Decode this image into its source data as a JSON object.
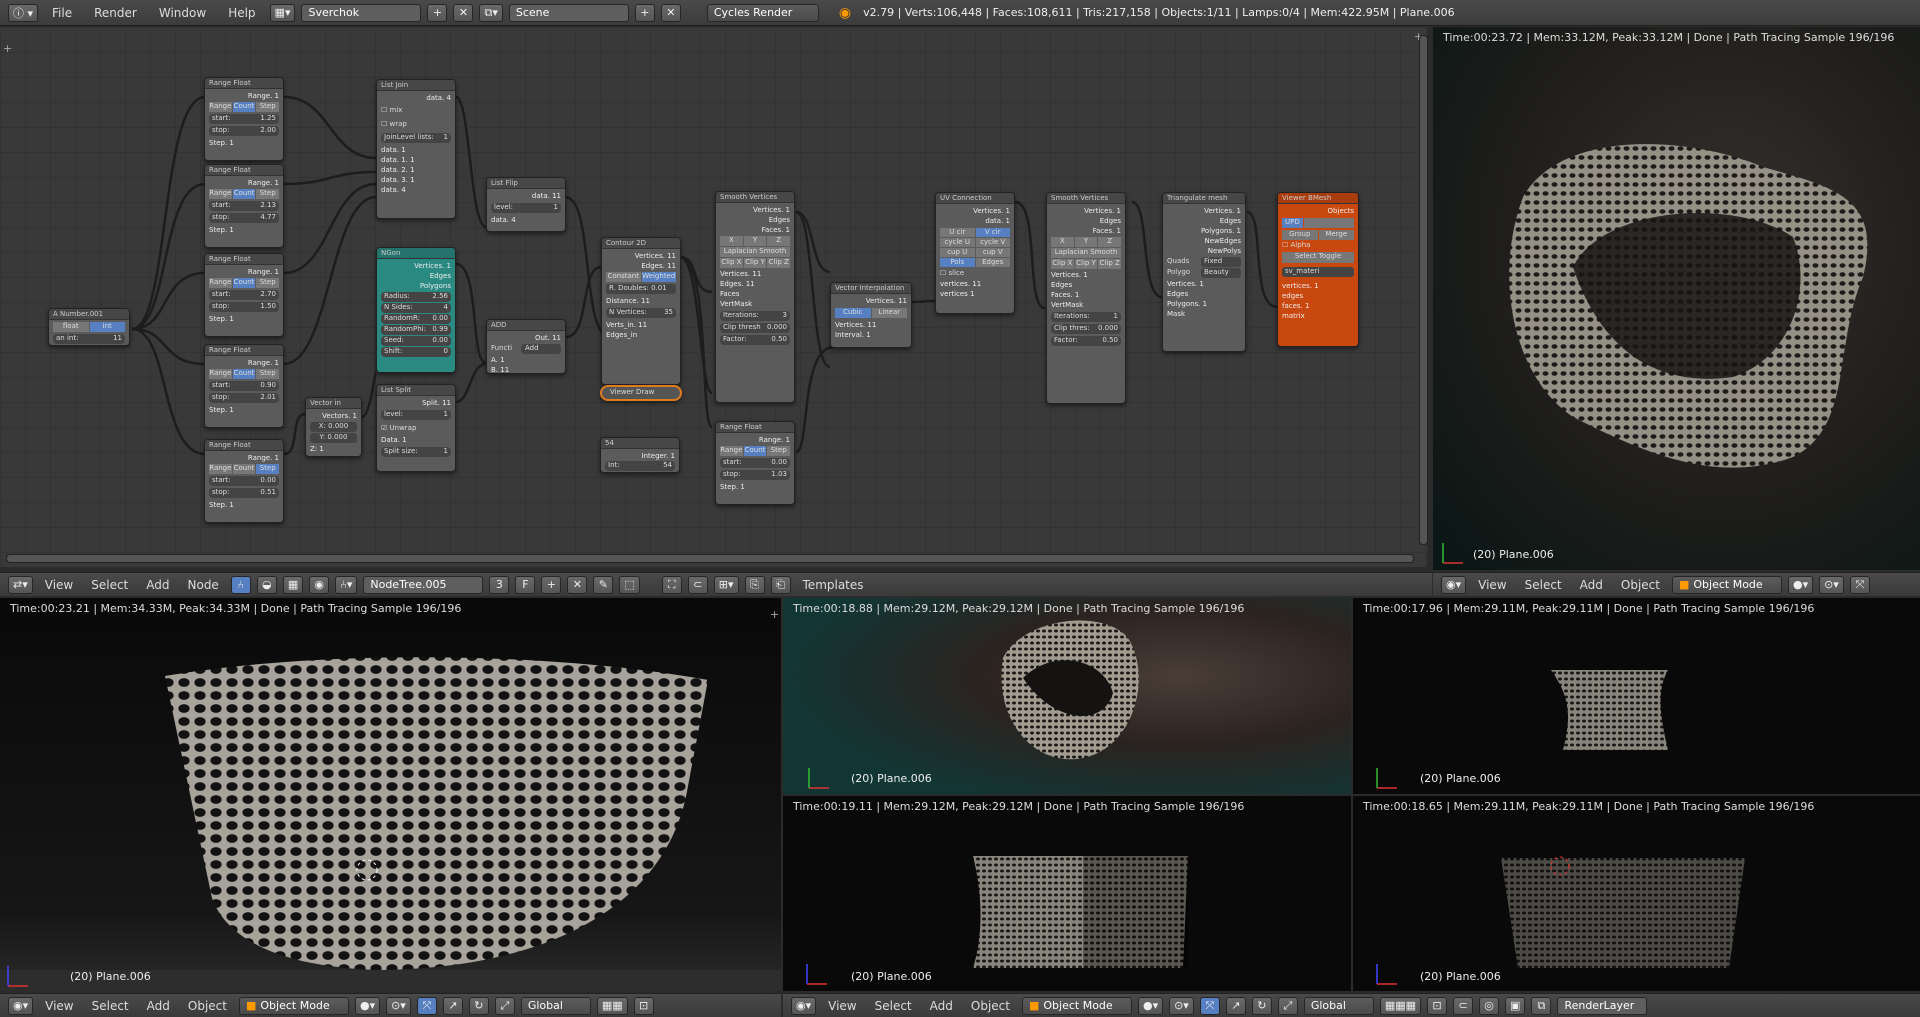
{
  "header": {
    "menus": [
      "File",
      "Render",
      "Window",
      "Help"
    ],
    "screen_name": "Sverchok",
    "scene_name": "Scene",
    "render_engine": "Cycles Render",
    "info": "v2.79 | Verts:106,448 | Faces:108,611 | Tris:217,158 | Objects:1/11 | Lamps:0/4 | Mem:422.95M | Plane.006"
  },
  "node_editor": {
    "toolbar": {
      "menus": [
        "View",
        "Select",
        "Add",
        "Node"
      ],
      "tree_name": "NodeTree.005",
      "users": "3",
      "fake_user": "F",
      "templates": "Templates"
    },
    "nodes": {
      "range1": {
        "title": "Range Float",
        "out": "Range. 1",
        "modes": [
          "Range",
          "Count",
          "Step"
        ],
        "start": "start:",
        "start_v": "1.25",
        "stop": "stop:",
        "stop_v": "2.00",
        "step": "Step. 1"
      },
      "range2": {
        "title": "Range Float",
        "out": "Range. 1",
        "modes": [
          "Range",
          "Count",
          "Step"
        ],
        "start": "start:",
        "start_v": "2.13",
        "stop": "stop:",
        "stop_v": "4.77",
        "step": "Step. 1"
      },
      "range3": {
        "title": "Range Float",
        "out": "Range. 1",
        "modes": [
          "Range",
          "Count",
          "Step"
        ],
        "start": "start:",
        "start_v": "2.70",
        "stop": "stop:",
        "stop_v": "1.50",
        "step": "Step. 1"
      },
      "range4": {
        "title": "Range Float",
        "out": "Range. 1",
        "modes": [
          "Range",
          "Count",
          "Step"
        ],
        "start": "start:",
        "start_v": "0.90",
        "stop": "stop:",
        "stop_v": "2.01",
        "step": "Step. 1"
      },
      "range5": {
        "title": "Range Float",
        "out": "Range. 1",
        "modes": [
          "Range",
          "Count",
          "Step"
        ],
        "start": "start:",
        "start_v": "0.00",
        "stop": "stop:",
        "stop_v": "0.51",
        "step": "Step. 1"
      },
      "anumber": {
        "title": "A Number.001",
        "mode_a": "float",
        "mode_b": "int",
        "val": "an int:",
        "val_v": "11"
      },
      "listjoin": {
        "title": "List Join",
        "out": "data. 4",
        "mix": "mix",
        "wrap": "wrap",
        "level": "JoinLevel lists:",
        "level_v": "1",
        "ins": [
          "data. 1",
          "data. 1. 1",
          "data. 2. 1",
          "data. 3. 1",
          "data. 4"
        ]
      },
      "ngon": {
        "title": "NGon",
        "outs": [
          "Vertices. 1",
          "Edges",
          "Polygons"
        ],
        "radius": "Radius:",
        "radius_v": "2.56",
        "nsides": "N Sides:",
        "nsides_v": "4",
        "randr": "RandomR:",
        "randr_v": "0.00",
        "randphi": "RandomPhi:",
        "randphi_v": "0.99",
        "seed": "Seed:",
        "seed_v": "0.00",
        "shift": "Shift:",
        "shift_v": "0"
      },
      "listflip": {
        "title": "List Flip",
        "out": "data. 11",
        "level": "level:",
        "level_v": "1",
        "in": "data. 4"
      },
      "add": {
        "title": "ADD",
        "out": "Out. 11",
        "func": "Functi",
        "func_v": "Add",
        "a": "A. 1",
        "b": "B. 11"
      },
      "vectorin": {
        "title": "Vector in",
        "out": "Vectors. 1",
        "x": "X: 0.000",
        "y": "Y: 0.000",
        "z": "Z: 1"
      },
      "listsplit": {
        "title": "List Split",
        "out": "Split. 11",
        "level": "level:",
        "level_v": "1",
        "unwrap": "Unwrap",
        "data": "Data. 1",
        "size": "Split size:",
        "size_v": "1"
      },
      "contour": {
        "title": "Contour 2D",
        "outs": [
          "Vertices. 11",
          "Edges. 11"
        ],
        "modes": [
          "Constant",
          "Weighted"
        ],
        "rdoubles": "R. Doubles: 0.01",
        "distance": "Distance. 11",
        "nverts": "N Vertices:",
        "nverts_v": "35",
        "vin": "Verts_in. 11",
        "ein": "Edges_in"
      },
      "viewerdraw": {
        "title": "Viewer Draw"
      },
      "num54": {
        "title": "54",
        "label": "Int:",
        "val": "54",
        "out": "Integer. 1"
      },
      "smooth1": {
        "title": "Smooth Vertices",
        "outs": [
          "Vertices. 1",
          "Edges",
          "Faces. 1"
        ],
        "xyz": [
          "X",
          "Y",
          "Z"
        ],
        "mode": "Laplacian Smooth",
        "clips": [
          "Clip X",
          "Clip Y",
          "Clip Z"
        ],
        "ins": [
          "Vertices. 11",
          "Edges. 11",
          "Faces",
          "VertMask"
        ],
        "iterations": "Iterations:",
        "iterations_v": "3",
        "clip": "Clip thresh",
        "clip_v": "0.000",
        "factor": "Factor:",
        "factor_v": "0.50"
      },
      "range6": {
        "title": "Range Float",
        "out": "Range. 1",
        "modes": [
          "Range",
          "Count",
          "Step"
        ],
        "start": "start:",
        "start_v": "0.00",
        "stop": "stop:",
        "stop_v": "1.03",
        "step": "Step. 1"
      },
      "vinterp": {
        "title": "Vector Interpolation",
        "out": "Vertices. 11",
        "modes": [
          "Cubic",
          "Linear"
        ],
        "ins": [
          "Vertices. 11",
          "Interval. 1"
        ]
      },
      "uvconn": {
        "title": "UV Connection",
        "outs": [
          "Vertices. 1",
          "data. 1"
        ],
        "grid": [
          "U cir",
          "V cir",
          "cycle U",
          "cycle V",
          "cup U",
          "cup V",
          "Pols",
          "Edges"
        ],
        "slice": "slice",
        "ins": [
          "vertices. 11",
          "vertices 1"
        ]
      },
      "smooth2": {
        "title": "Smooth Vertices",
        "outs": [
          "Vertices. 1",
          "Edges",
          "Faces. 1"
        ],
        "xyz": [
          "X",
          "Y",
          "Z"
        ],
        "mode": "Laplacian Smooth",
        "clips": [
          "Clip X",
          "Clip Y",
          "Clip Z"
        ],
        "ins": [
          "Vertices. 1",
          "Edges",
          "Faces. 1",
          "VertMask"
        ],
        "iterations": "Iterations:",
        "iterations_v": "1",
        "clip": "Clip thres:",
        "clip_v": "0.000",
        "factor": "Factor:",
        "factor_v": "0.50"
      },
      "triangulate": {
        "title": "Triangulate mesh",
        "outs": [
          "Vertices. 1",
          "Edges",
          "Polygons. 1",
          "NewEdges",
          "NewPolys"
        ],
        "quads": "Quads",
        "quads_v": "Fixed",
        "polys": "Polygo",
        "polys_v": "Beauty",
        "ins": [
          "Vertices. 1",
          "Edges",
          "Polygons. 1",
          "Mask"
        ]
      },
      "viewerbmesh": {
        "title": "Viewer BMesh",
        "out": "Objects",
        "upd": "UPD",
        "group": "Group",
        "merge": "Merge",
        "alpha": "Alpha",
        "select": "Select Toggle",
        "material": "sv_materi",
        "ins": [
          "vertices. 1",
          "edges",
          "faces. 1",
          "matrix"
        ]
      }
    }
  },
  "viewport_tr": {
    "stat": "Time:00:23.72 | Mem:33.12M, Peak:33.12M | Done | Path Tracing Sample 196/196",
    "object": "(20) Plane.006",
    "toolbar": {
      "menus": [
        "View",
        "Select",
        "Add",
        "Object"
      ],
      "mode": "Object Mode"
    }
  },
  "viewport_bl": {
    "stat": "Time:00:23.21 | Mem:34.33M, Peak:34.33M | Done | Path Tracing Sample 196/196",
    "object": "(20) Plane.006",
    "toolbar": {
      "menus": [
        "View",
        "Select",
        "Add",
        "Object"
      ],
      "mode": "Object Mode",
      "orientation": "Global"
    }
  },
  "viewport_m1": {
    "stat": "Time:00:18.88 | Mem:29.12M, Peak:29.12M | Done | Path Tracing Sample 196/196",
    "object": "(20) Plane.006"
  },
  "viewport_r1": {
    "stat": "Time:00:17.96 | Mem:29.11M, Peak:29.11M | Done | Path Tracing Sample 196/196",
    "object": "(20) Plane.006"
  },
  "viewport_m2": {
    "stat": "Time:00:19.11 | Mem:29.12M, Peak:29.12M | Done | Path Tracing Sample 196/196",
    "object": "(20) Plane.006"
  },
  "viewport_r2": {
    "stat": "Time:00:18.65 | Mem:29.11M, Peak:29.11M | Done | Path Tracing Sample 196/196",
    "object": "(20) Plane.006"
  },
  "bottom_toolbar_right": {
    "menus": [
      "View",
      "Select",
      "Add",
      "Object"
    ],
    "mode": "Object Mode",
    "orientation": "Global",
    "render_layer": "RenderLayer"
  }
}
